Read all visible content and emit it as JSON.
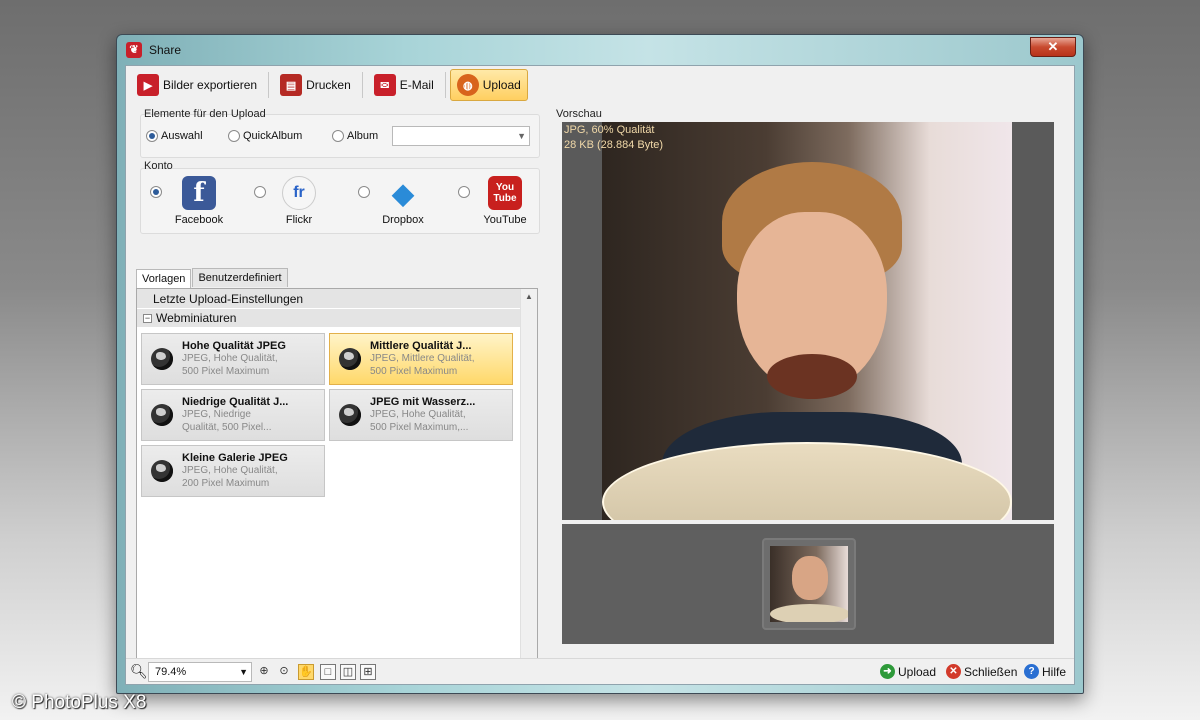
{
  "window": {
    "title": "Share",
    "close_label": "✕"
  },
  "toolbar": {
    "items": [
      {
        "label": "Bilder exportieren",
        "icon": "export-icon"
      },
      {
        "label": "Drucken",
        "icon": "printer-icon"
      },
      {
        "label": "E-Mail",
        "icon": "mail-icon"
      },
      {
        "label": "Upload",
        "icon": "upload-globe-icon",
        "active": true
      }
    ]
  },
  "elements": {
    "group_label": "Elemente für den Upload",
    "options": [
      "Auswahl",
      "QuickAlbum",
      "Album"
    ],
    "selected": "Auswahl",
    "album_value": ""
  },
  "account": {
    "group_label": "Konto",
    "services": [
      {
        "name": "Facebook",
        "logo_text": "f",
        "color": "#3b5998",
        "selected": true
      },
      {
        "name": "Flickr",
        "logo_text": "fr",
        "color": "#ffffff",
        "selected": false
      },
      {
        "name": "Dropbox",
        "logo_text": "◆",
        "color": "#2a8bd8",
        "selected": false
      },
      {
        "name": "YouTube",
        "logo_text": "You Tube",
        "color": "#c8201e",
        "selected": false
      }
    ]
  },
  "templates": {
    "tabs": [
      "Vorlagen",
      "Benutzerdefiniert"
    ],
    "active_tab": "Vorlagen",
    "last_settings": "Letzte Upload-Einstellungen",
    "section": "Webminiaturen",
    "tiles": [
      {
        "title": "Hohe Qualität JPEG",
        "sub1": "JPEG, Hohe Qualität,",
        "sub2": "500 Pixel Maximum",
        "selected": false
      },
      {
        "title": "Mittlere Qualität J...",
        "sub1": "JPEG, Mittlere Qualität,",
        "sub2": "500 Pixel Maximum",
        "selected": true
      },
      {
        "title": "Niedrige Qualität J...",
        "sub1": "JPEG, Niedrige",
        "sub2": "Qualität, 500 Pixel...",
        "selected": false
      },
      {
        "title": "JPEG mit Wasserz...",
        "sub1": "JPEG, Hohe Qualität,",
        "sub2": "500 Pixel Maximum,...",
        "selected": false
      },
      {
        "title": "Kleine Galerie JPEG",
        "sub1": "JPEG, Hohe Qualität,",
        "sub2": "200 Pixel Maximum",
        "selected": false
      }
    ]
  },
  "preview": {
    "label": "Vorschau",
    "info_line1": "JPG, 60% Qualität",
    "info_line2": "28 KB (28.884 Byte)"
  },
  "bottom": {
    "zoom": "79.4%",
    "actions": [
      {
        "label": "Upload",
        "color": "#2e9a3a",
        "glyph": "➜"
      },
      {
        "label": "Schließen",
        "color": "#d23a2a",
        "glyph": "✕"
      },
      {
        "label": "Hilfe",
        "color": "#2a6fd2",
        "glyph": "?"
      }
    ]
  },
  "watermark": "© PhotoPlus X8"
}
